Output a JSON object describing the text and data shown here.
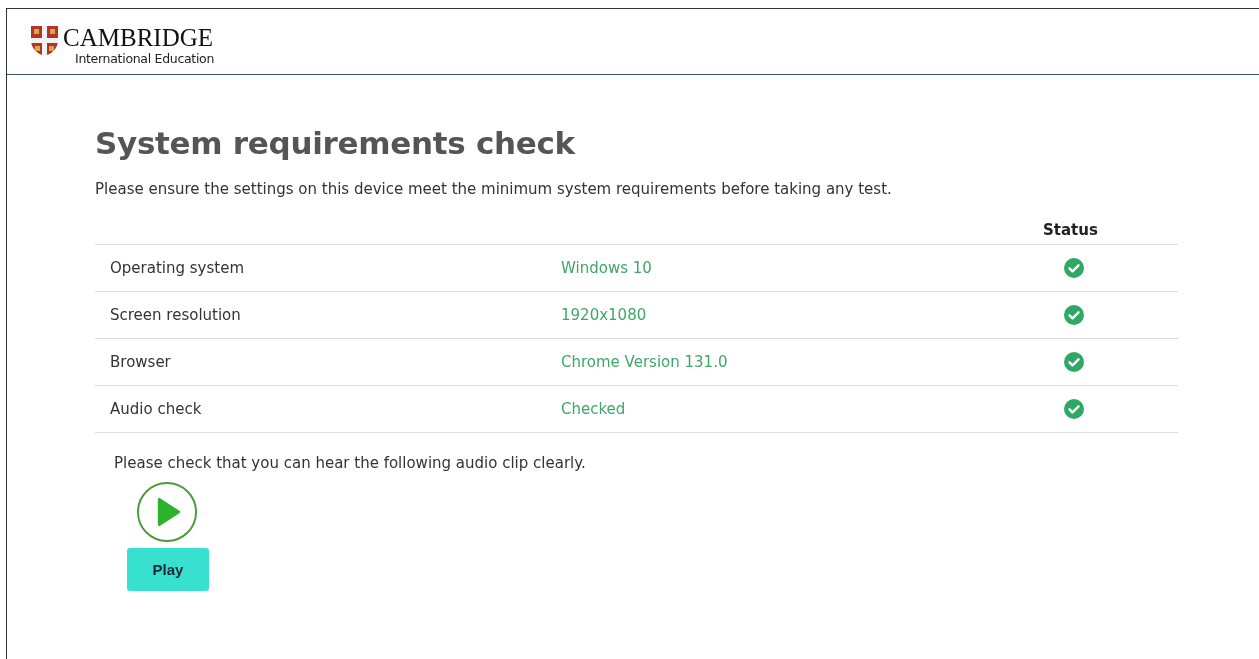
{
  "header": {
    "logo_title": "CAMBRIDGE",
    "logo_subtitle": "International Education"
  },
  "title": "System requirements check",
  "intro": "Please ensure the settings on this device meet the minimum system requirements before taking any test.",
  "table": {
    "columns": [
      "Status"
    ],
    "rows": [
      {
        "name": "Operating system",
        "value": "Windows 10",
        "passed": true
      },
      {
        "name": "Screen resolution",
        "value": "1920x1080",
        "passed": true
      },
      {
        "name": "Browser",
        "value": "Chrome Version 131.0",
        "passed": true
      },
      {
        "name": "Audio check",
        "value": "Checked",
        "passed": true
      }
    ]
  },
  "audio": {
    "prompt": "Please check that you can hear the following audio clip clearly.",
    "button": "Play"
  }
}
